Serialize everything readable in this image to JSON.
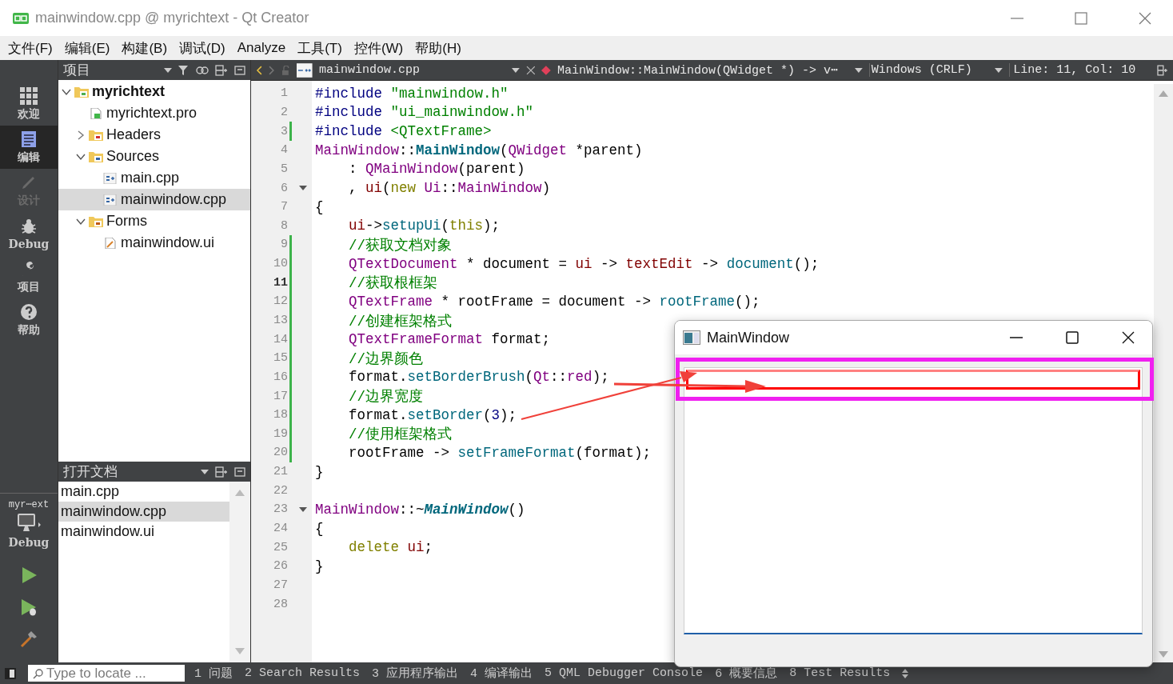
{
  "window": {
    "title": "mainwindow.cpp @ myrichtext - Qt Creator"
  },
  "menu": [
    "文件(F)",
    "编辑(E)",
    "构建(B)",
    "调试(D)",
    "Analyze",
    "工具(T)",
    "控件(W)",
    "帮助(H)"
  ],
  "mode_bar": {
    "modes": [
      {
        "label": "欢迎",
        "selected": false,
        "disabled": false
      },
      {
        "label": "编辑",
        "selected": true,
        "disabled": false
      },
      {
        "label": "设计",
        "selected": false,
        "disabled": true
      },
      {
        "label": "Debug",
        "selected": false,
        "disabled": false
      },
      {
        "label": "项目",
        "selected": false,
        "disabled": false
      },
      {
        "label": "帮助",
        "selected": false,
        "disabled": false
      }
    ],
    "kit": {
      "project": "myr⋯ext",
      "build": "Debug"
    }
  },
  "project_panel": {
    "title": "项目",
    "tree": [
      {
        "label": "myrichtext",
        "kind": "project",
        "expanded": true,
        "selected": false,
        "children": [
          {
            "label": "myrichtext.pro",
            "kind": "pro-file",
            "selected": false
          },
          {
            "label": "Headers",
            "kind": "header-folder",
            "expanded": false,
            "selected": false
          },
          {
            "label": "Sources",
            "kind": "source-folder",
            "expanded": true,
            "selected": false,
            "children": [
              {
                "label": "main.cpp",
                "kind": "cpp-file",
                "selected": false
              },
              {
                "label": "mainwindow.cpp",
                "kind": "cpp-file",
                "selected": true
              }
            ]
          },
          {
            "label": "Forms",
            "kind": "form-folder",
            "expanded": true,
            "selected": false,
            "children": [
              {
                "label": "mainwindow.ui",
                "kind": "ui-file",
                "selected": false
              }
            ]
          }
        ]
      }
    ]
  },
  "open_documents": {
    "title": "打开文档",
    "items": [
      {
        "label": "main.cpp",
        "selected": false
      },
      {
        "label": "mainwindow.cpp",
        "selected": true
      },
      {
        "label": "mainwindow.ui",
        "selected": false
      }
    ]
  },
  "editor": {
    "file": "mainwindow.cpp",
    "symbol": "MainWindow::MainWindow(QWidget *) -> v⋯",
    "line_endings": "Windows (CRLF)",
    "position": "Line: 11, Col: 10",
    "lines": [
      {
        "number": "1",
        "modified": false,
        "current": false,
        "foldable": false,
        "segments": [
          {
            "text": "#include ",
            "kind": "pre"
          },
          {
            "text": "\"mainwindow.h\"",
            "kind": "str"
          }
        ]
      },
      {
        "number": "2",
        "modified": false,
        "current": false,
        "foldable": false,
        "segments": [
          {
            "text": "#include ",
            "kind": "pre"
          },
          {
            "text": "\"ui_mainwindow.h\"",
            "kind": "str"
          }
        ]
      },
      {
        "number": "3",
        "modified": true,
        "current": false,
        "foldable": false,
        "segments": [
          {
            "text": "#include ",
            "kind": "pre"
          },
          {
            "text": "<QTextFrame>",
            "kind": "str"
          }
        ]
      },
      {
        "number": "4",
        "modified": false,
        "current": false,
        "foldable": false,
        "segments": [
          {
            "text": "MainWindow",
            "kind": "type"
          },
          {
            "text": "::",
            "kind": "plain"
          },
          {
            "text": "MainWindow",
            "kind": "decl"
          },
          {
            "text": "(",
            "kind": "plain"
          },
          {
            "text": "QWidget",
            "kind": "type"
          },
          {
            "text": " *parent)",
            "kind": "plain"
          }
        ]
      },
      {
        "number": "5",
        "modified": false,
        "current": false,
        "foldable": false,
        "segments": [
          {
            "text": "    : ",
            "kind": "plain"
          },
          {
            "text": "QMainWindow",
            "kind": "type"
          },
          {
            "text": "(parent)",
            "kind": "plain"
          }
        ]
      },
      {
        "number": "6",
        "modified": false,
        "current": false,
        "foldable": true,
        "segments": [
          {
            "text": "    , ",
            "kind": "plain"
          },
          {
            "text": "ui",
            "kind": "member"
          },
          {
            "text": "(",
            "kind": "plain"
          },
          {
            "text": "new",
            "kind": "kw"
          },
          {
            "text": " Ui",
            "kind": "type"
          },
          {
            "text": "::",
            "kind": "plain"
          },
          {
            "text": "MainWindow",
            "kind": "type"
          },
          {
            "text": ")",
            "kind": "plain"
          }
        ]
      },
      {
        "number": "7",
        "modified": false,
        "current": false,
        "foldable": false,
        "segments": [
          {
            "text": "{",
            "kind": "plain"
          }
        ]
      },
      {
        "number": "8",
        "modified": false,
        "current": false,
        "foldable": false,
        "segments": [
          {
            "text": "    ui",
            "kind": "member"
          },
          {
            "text": "->",
            "kind": "plain"
          },
          {
            "text": "setupUi",
            "kind": "fn"
          },
          {
            "text": "(",
            "kind": "plain"
          },
          {
            "text": "this",
            "kind": "kw"
          },
          {
            "text": ");",
            "kind": "plain"
          }
        ]
      },
      {
        "number": "9",
        "modified": true,
        "current": false,
        "foldable": false,
        "segments": [
          {
            "text": "    //获取文档对象",
            "kind": "comment"
          }
        ]
      },
      {
        "number": "10",
        "modified": true,
        "current": false,
        "foldable": false,
        "segments": [
          {
            "text": "    QTextDocument",
            "kind": "type"
          },
          {
            "text": " * document = ",
            "kind": "plain"
          },
          {
            "text": "ui",
            "kind": "member"
          },
          {
            "text": " -> ",
            "kind": "plain"
          },
          {
            "text": "textEdit",
            "kind": "member"
          },
          {
            "text": " -> ",
            "kind": "plain"
          },
          {
            "text": "document",
            "kind": "fn"
          },
          {
            "text": "();",
            "kind": "plain"
          }
        ]
      },
      {
        "number": "11",
        "modified": true,
        "current": true,
        "foldable": false,
        "segments": [
          {
            "text": "    //获取根框架",
            "kind": "comment"
          }
        ]
      },
      {
        "number": "12",
        "modified": true,
        "current": false,
        "foldable": false,
        "segments": [
          {
            "text": "    QTextFrame",
            "kind": "type"
          },
          {
            "text": " * rootFrame = document -> ",
            "kind": "plain"
          },
          {
            "text": "rootFrame",
            "kind": "fn"
          },
          {
            "text": "();",
            "kind": "plain"
          }
        ]
      },
      {
        "number": "13",
        "modified": true,
        "current": false,
        "foldable": false,
        "segments": [
          {
            "text": "    //创建框架格式",
            "kind": "comment"
          }
        ]
      },
      {
        "number": "14",
        "modified": true,
        "current": false,
        "foldable": false,
        "segments": [
          {
            "text": "    QTextFrameFormat",
            "kind": "type"
          },
          {
            "text": " format;",
            "kind": "plain"
          }
        ]
      },
      {
        "number": "15",
        "modified": true,
        "current": false,
        "foldable": false,
        "segments": [
          {
            "text": "    //边界颜色",
            "kind": "comment"
          }
        ]
      },
      {
        "number": "16",
        "modified": true,
        "current": false,
        "foldable": false,
        "segments": [
          {
            "text": "    format.",
            "kind": "plain"
          },
          {
            "text": "setBorderBrush",
            "kind": "fn"
          },
          {
            "text": "(",
            "kind": "plain"
          },
          {
            "text": "Qt",
            "kind": "type"
          },
          {
            "text": "::",
            "kind": "plain"
          },
          {
            "text": "red",
            "kind": "type"
          },
          {
            "text": ");",
            "kind": "plain"
          }
        ]
      },
      {
        "number": "17",
        "modified": true,
        "current": false,
        "foldable": false,
        "segments": [
          {
            "text": "    //边界宽度",
            "kind": "comment"
          }
        ]
      },
      {
        "number": "18",
        "modified": true,
        "current": false,
        "foldable": false,
        "segments": [
          {
            "text": "    format.",
            "kind": "plain"
          },
          {
            "text": "setBorder",
            "kind": "fn"
          },
          {
            "text": "(",
            "kind": "plain"
          },
          {
            "text": "3",
            "kind": "num"
          },
          {
            "text": ");",
            "kind": "plain"
          }
        ]
      },
      {
        "number": "19",
        "modified": true,
        "current": false,
        "foldable": false,
        "segments": [
          {
            "text": "    //使用框架格式",
            "kind": "comment"
          }
        ]
      },
      {
        "number": "20",
        "modified": true,
        "current": false,
        "foldable": false,
        "segments": [
          {
            "text": "    rootFrame -> ",
            "kind": "plain"
          },
          {
            "text": "setFrameFormat",
            "kind": "fn"
          },
          {
            "text": "(format);",
            "kind": "plain"
          }
        ]
      },
      {
        "number": "21",
        "modified": false,
        "current": false,
        "foldable": false,
        "segments": [
          {
            "text": "}",
            "kind": "plain"
          }
        ]
      },
      {
        "number": "22",
        "modified": false,
        "current": false,
        "foldable": false
      },
      {
        "number": "23",
        "modified": false,
        "current": false,
        "foldable": true,
        "segments": [
          {
            "text": "MainWindow",
            "kind": "type"
          },
          {
            "text": "::~",
            "kind": "plain"
          },
          {
            "text": "MainWindow",
            "kind": "decl-italic"
          },
          {
            "text": "()",
            "kind": "plain"
          }
        ]
      },
      {
        "number": "24",
        "modified": false,
        "current": false,
        "foldable": false,
        "segments": [
          {
            "text": "{",
            "kind": "plain"
          }
        ]
      },
      {
        "number": "25",
        "modified": false,
        "current": false,
        "foldable": false,
        "segments": [
          {
            "text": "    delete",
            "kind": "kw"
          },
          {
            "text": " ui",
            "kind": "member"
          },
          {
            "text": ";",
            "kind": "plain"
          }
        ]
      },
      {
        "number": "26",
        "modified": false,
        "current": false,
        "foldable": false,
        "segments": [
          {
            "text": "}",
            "kind": "plain"
          }
        ]
      },
      {
        "number": "27",
        "modified": false,
        "current": false,
        "foldable": false
      },
      {
        "number": "28",
        "modified": false,
        "current": false,
        "foldable": false
      }
    ]
  },
  "status_bar": {
    "locate": {
      "placeholder": "Type to locate ..."
    },
    "panes": [
      "1 问题",
      "2 Search Results",
      "3 应用程序输出",
      "4 编译输出",
      "5 QML Debugger Console",
      "6 概要信息",
      "8 Test Results"
    ]
  },
  "app_window": {
    "title": "MainWindow"
  }
}
